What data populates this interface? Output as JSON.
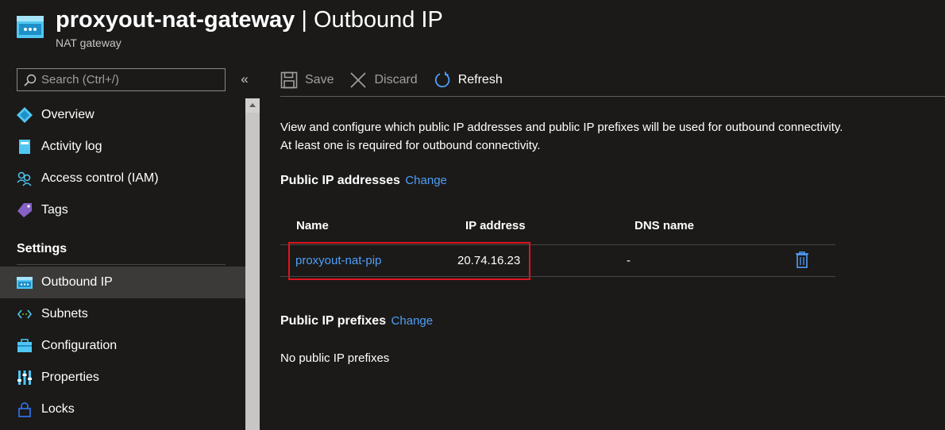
{
  "header": {
    "resource_name": "proxyout-nat-gateway",
    "separator": " | ",
    "blade_title": "Outbound IP",
    "resource_type": "NAT gateway"
  },
  "sidebar": {
    "search_placeholder": "Search (Ctrl+/)",
    "collapse_glyph": "«",
    "items": [
      {
        "label": "Overview",
        "icon": "overview-icon"
      },
      {
        "label": "Activity log",
        "icon": "activity-log-icon"
      },
      {
        "label": "Access control (IAM)",
        "icon": "iam-icon"
      },
      {
        "label": "Tags",
        "icon": "tag-icon"
      }
    ],
    "settings_heading": "Settings",
    "settings_items": [
      {
        "label": "Outbound IP",
        "icon": "outbound-ip-icon",
        "active": true
      },
      {
        "label": "Subnets",
        "icon": "subnets-icon"
      },
      {
        "label": "Configuration",
        "icon": "configuration-icon"
      },
      {
        "label": "Properties",
        "icon": "properties-icon"
      },
      {
        "label": "Locks",
        "icon": "lock-icon"
      }
    ]
  },
  "toolbar": {
    "save_label": "Save",
    "discard_label": "Discard",
    "refresh_label": "Refresh"
  },
  "main": {
    "description": "View and configure which public IP addresses and public IP prefixes will be used for outbound connectivity. At least one is required for outbound connectivity.",
    "public_ips": {
      "heading": "Public IP addresses",
      "change_link": "Change",
      "columns": [
        "Name",
        "IP address",
        "DNS name"
      ],
      "rows": [
        {
          "name": "proxyout-nat-pip",
          "ip": "20.74.16.23",
          "dns": "-"
        }
      ]
    },
    "prefixes": {
      "heading": "Public IP prefixes",
      "change_link": "Change",
      "empty_text": "No public IP prefixes"
    }
  },
  "colors": {
    "background": "#1b1a19",
    "link": "#4f9ff8",
    "highlight": "#e0141e",
    "active_nav": "#3b3a39"
  }
}
